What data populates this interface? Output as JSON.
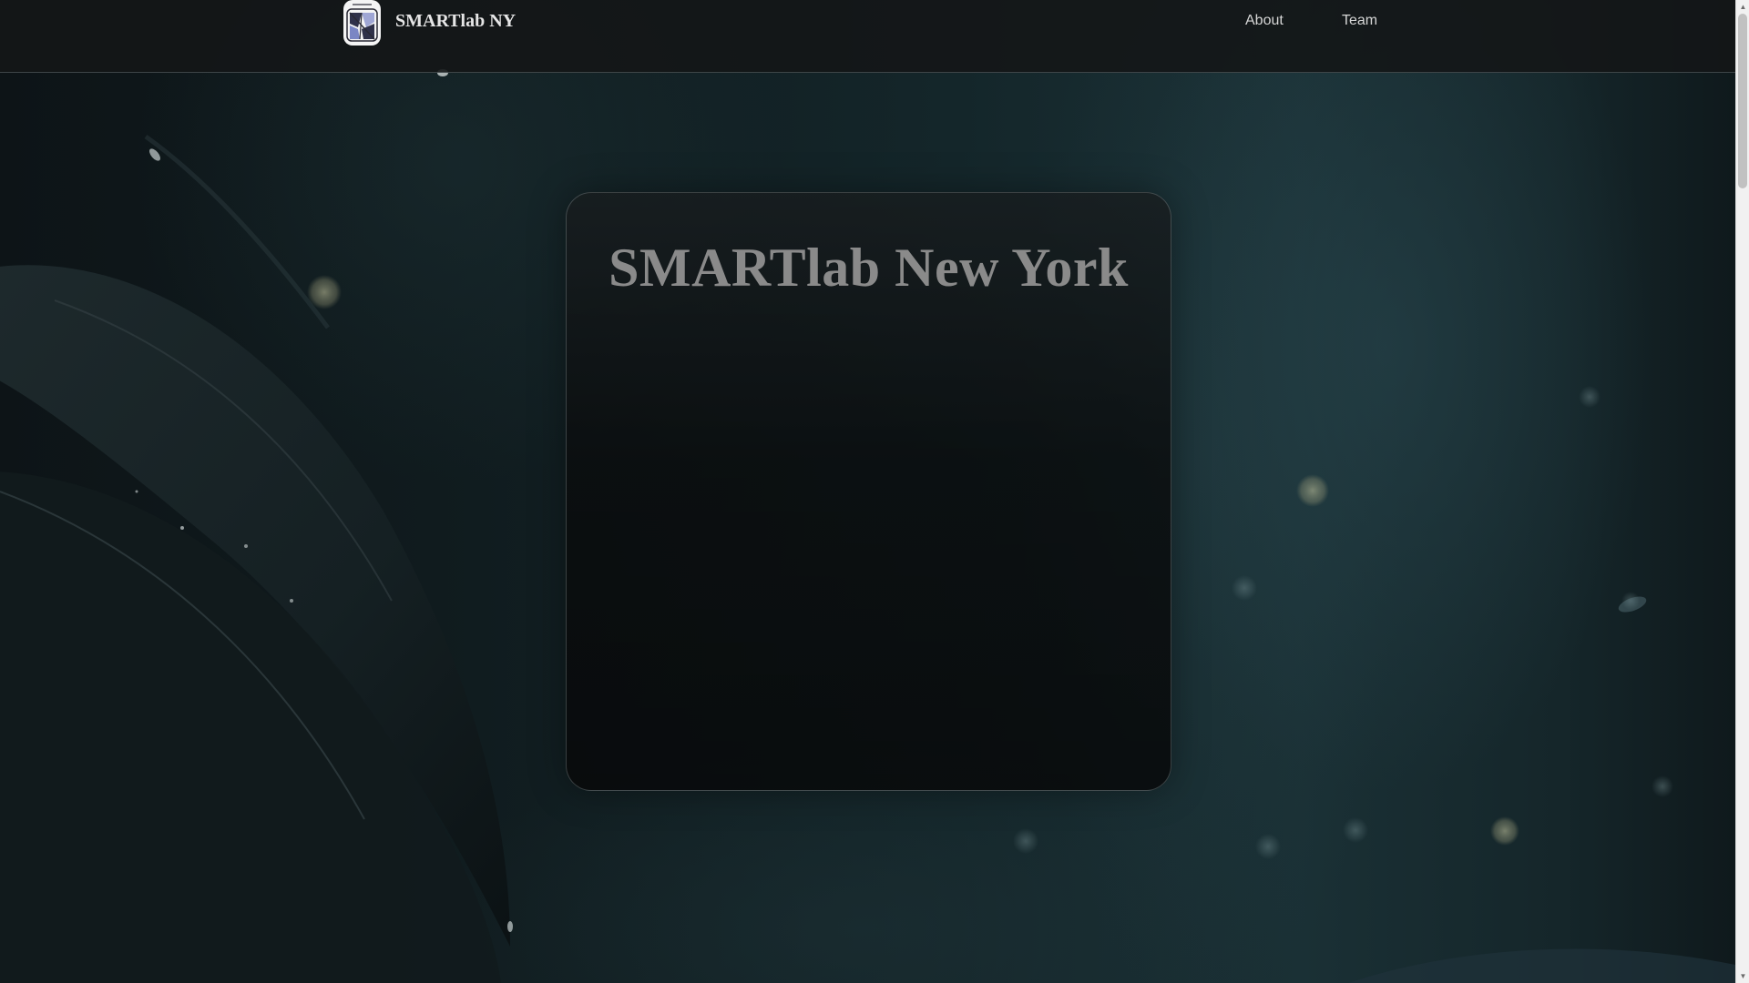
{
  "header": {
    "brand": "SMARTlab NY",
    "logo_icon": "smartlab-logo-icon",
    "nav": [
      {
        "label": "About"
      },
      {
        "label": "Team"
      }
    ]
  },
  "hero": {
    "title": "SMARTlab New York"
  },
  "colors": {
    "header_bg": "#141617",
    "brand_text": "#e6e6e6",
    "nav_text": "#d6d6d6",
    "hero_title": "#8a8a8a",
    "card_border": "#969fa3"
  }
}
